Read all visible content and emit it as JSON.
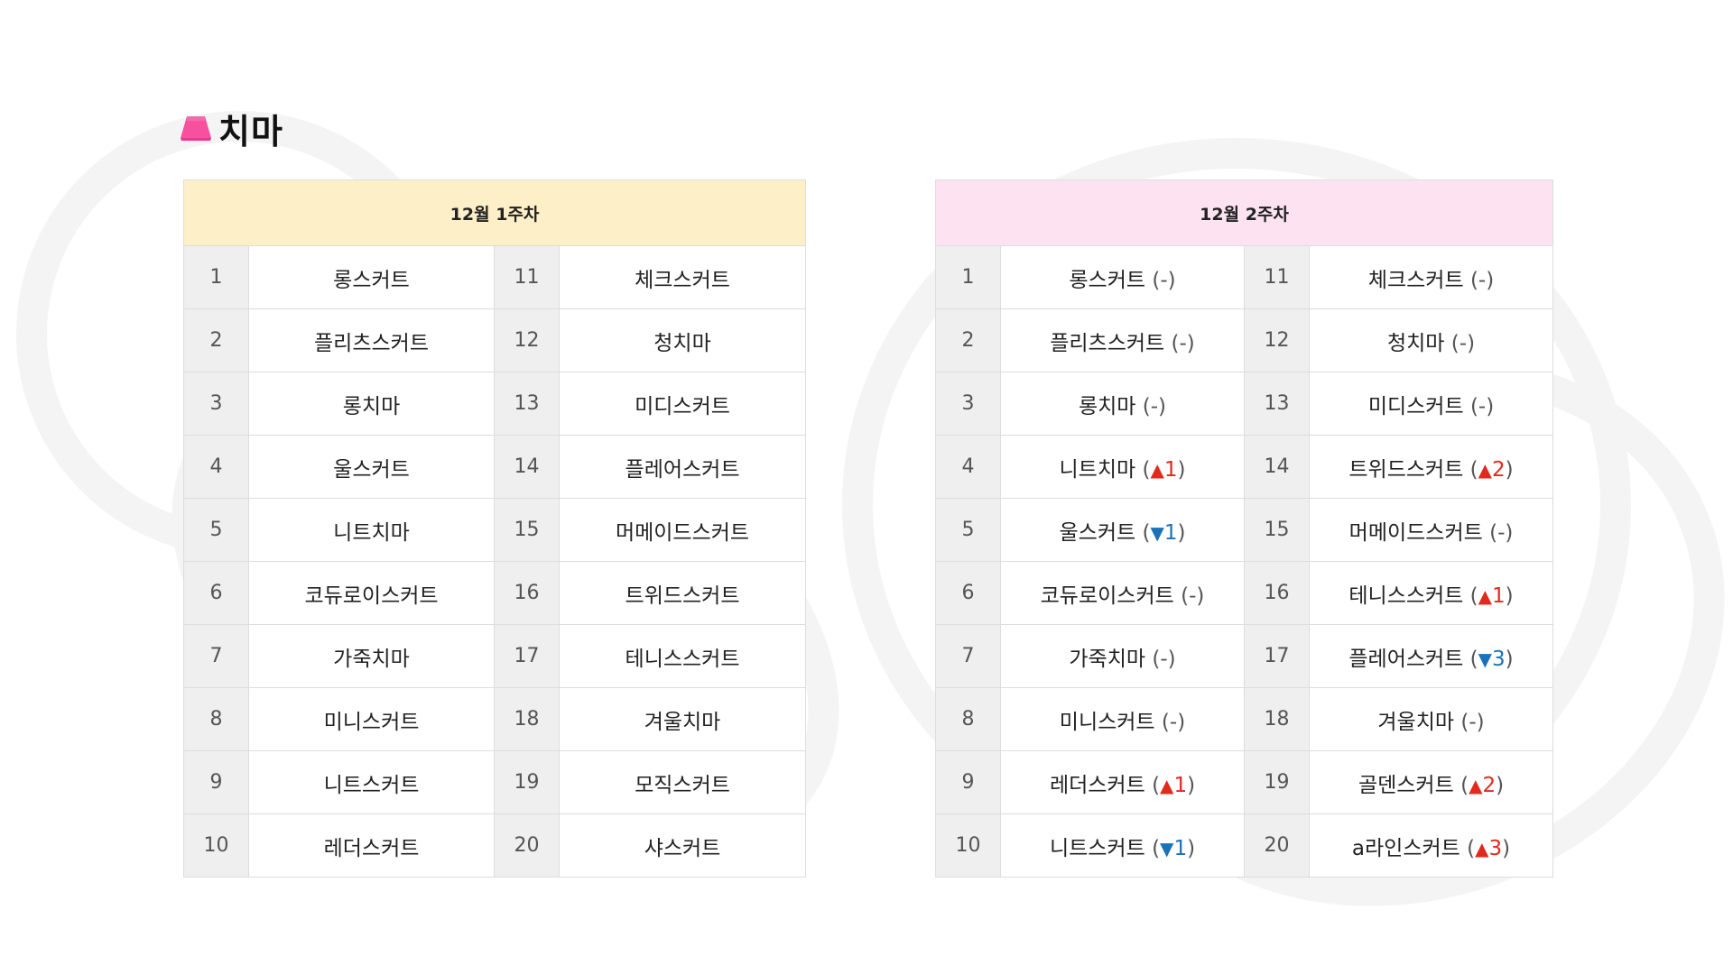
{
  "section": {
    "title": "치마",
    "icon": "skirt-icon",
    "icon_color": "#f7509e"
  },
  "colors": {
    "week1_header_bg": "#fdf0c8",
    "week2_header_bg": "#fde3f1",
    "up": "#e02a1d",
    "down": "#1b72b8"
  },
  "week1": {
    "header": "12월 1주차",
    "items": [
      {
        "rank": "1",
        "name": "롱스커트"
      },
      {
        "rank": "2",
        "name": "플리츠스커트"
      },
      {
        "rank": "3",
        "name": "롱치마"
      },
      {
        "rank": "4",
        "name": "울스커트"
      },
      {
        "rank": "5",
        "name": "니트치마"
      },
      {
        "rank": "6",
        "name": "코듀로이스커트"
      },
      {
        "rank": "7",
        "name": "가죽치마"
      },
      {
        "rank": "8",
        "name": "미니스커트"
      },
      {
        "rank": "9",
        "name": "니트스커트"
      },
      {
        "rank": "10",
        "name": "레더스커트"
      },
      {
        "rank": "11",
        "name": "체크스커트"
      },
      {
        "rank": "12",
        "name": "청치마"
      },
      {
        "rank": "13",
        "name": "미디스커트"
      },
      {
        "rank": "14",
        "name": "플레어스커트"
      },
      {
        "rank": "15",
        "name": "머메이드스커트"
      },
      {
        "rank": "16",
        "name": "트위드스커트"
      },
      {
        "rank": "17",
        "name": "테니스스커트"
      },
      {
        "rank": "18",
        "name": "겨울치마"
      },
      {
        "rank": "19",
        "name": "모직스커트"
      },
      {
        "rank": "20",
        "name": "샤스커트"
      }
    ]
  },
  "week2": {
    "header": "12월 2주차",
    "items": [
      {
        "rank": "1",
        "name": "롱스커트",
        "change": "same",
        "change_text": "-"
      },
      {
        "rank": "2",
        "name": "플리츠스커트",
        "change": "same",
        "change_text": "-"
      },
      {
        "rank": "3",
        "name": "롱치마",
        "change": "same",
        "change_text": "-"
      },
      {
        "rank": "4",
        "name": "니트치마",
        "change": "up",
        "change_text": "1"
      },
      {
        "rank": "5",
        "name": "울스커트",
        "change": "down",
        "change_text": "1"
      },
      {
        "rank": "6",
        "name": "코듀로이스커트",
        "change": "same",
        "change_text": "-"
      },
      {
        "rank": "7",
        "name": "가죽치마",
        "change": "same",
        "change_text": "-"
      },
      {
        "rank": "8",
        "name": "미니스커트",
        "change": "same",
        "change_text": "-"
      },
      {
        "rank": "9",
        "name": "레더스커트",
        "change": "up",
        "change_text": "1"
      },
      {
        "rank": "10",
        "name": "니트스커트",
        "change": "down",
        "change_text": "1"
      },
      {
        "rank": "11",
        "name": "체크스커트",
        "change": "same",
        "change_text": "-"
      },
      {
        "rank": "12",
        "name": "청치마",
        "change": "same",
        "change_text": "-"
      },
      {
        "rank": "13",
        "name": "미디스커트",
        "change": "same",
        "change_text": "-"
      },
      {
        "rank": "14",
        "name": "트위드스커트",
        "change": "up",
        "change_text": "2"
      },
      {
        "rank": "15",
        "name": "머메이드스커트",
        "change": "same",
        "change_text": "-"
      },
      {
        "rank": "16",
        "name": "테니스스커트",
        "change": "up",
        "change_text": "1"
      },
      {
        "rank": "17",
        "name": "플레어스커트",
        "change": "down",
        "change_text": "3"
      },
      {
        "rank": "18",
        "name": "겨울치마",
        "change": "same",
        "change_text": "-"
      },
      {
        "rank": "19",
        "name": "골덴스커트",
        "change": "up",
        "change_text": "2"
      },
      {
        "rank": "20",
        "name": "a라인스커트",
        "change": "up",
        "change_text": "3"
      }
    ]
  }
}
